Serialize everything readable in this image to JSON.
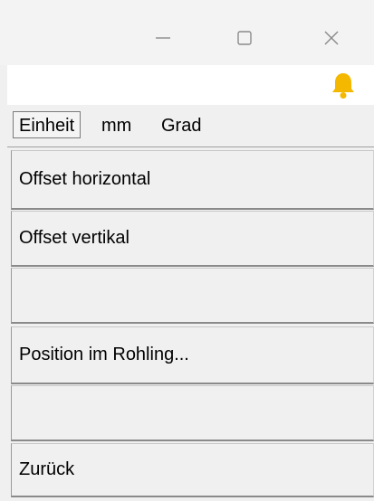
{
  "window": {
    "minimize_icon": "minimize-icon",
    "maximize_icon": "maximize-icon",
    "close_icon": "close-icon"
  },
  "notification": {
    "icon": "bell-icon",
    "color": "#f5b800"
  },
  "unit_bar": {
    "unit_button_label": "Einheit",
    "length_unit": "mm",
    "angle_unit": "Grad"
  },
  "menu": {
    "items": [
      {
        "label": "Offset horizontal"
      },
      {
        "label": "Offset vertikal"
      },
      {
        "label": ""
      },
      {
        "label": "Position im Rohling..."
      },
      {
        "label": ""
      },
      {
        "label": "Zurück"
      }
    ]
  }
}
